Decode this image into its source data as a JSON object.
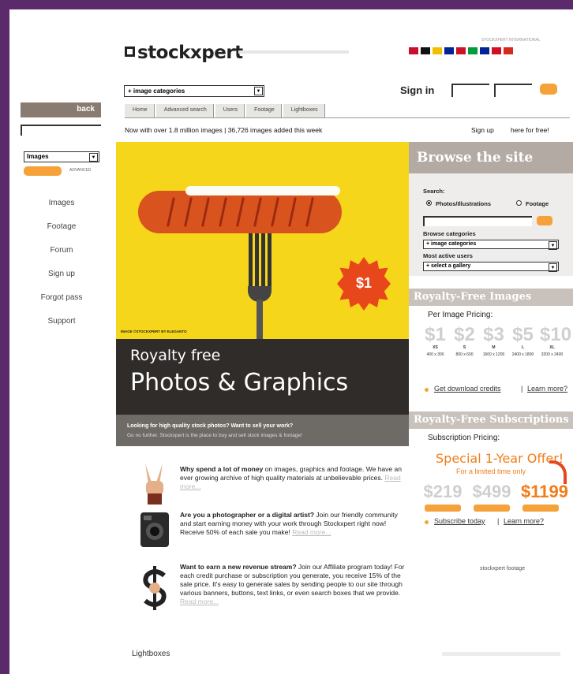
{
  "header": {
    "logo_text": "stockxpert",
    "international_label": "STOCKXPERT INTERNATIONAL",
    "flag_colors": [
      "#c8102e",
      "#111111",
      "#f1bf00",
      "#002395",
      "#ce1126",
      "#009b3a",
      "#002395",
      "#ce1126",
      "#d52b1e"
    ],
    "category_select": "+ image categories",
    "sign_in": "Sign in",
    "stats": "Now with over 1.8 million images | 36,726 images added this week",
    "sign_up": "Sign up",
    "free": "here for free!"
  },
  "tabs": [
    "Home",
    "Advanced search",
    "Users",
    "Footage",
    "Lightboxes"
  ],
  "left": {
    "back": "back",
    "select": "Images",
    "advanced": "ADVANCED",
    "nav": [
      "Images",
      "Footage",
      "Forum",
      "Sign up",
      "Forgot pass",
      "Support"
    ]
  },
  "hero": {
    "price_badge": "$1",
    "credit": "IMAGE ©STOCKXPERT BY ELEGANTO",
    "line1": "Royalty free",
    "line2": "Photos & Graphics",
    "tag1": "Looking for high quality stock photos? Want to sell your work?",
    "tag2": "Go no further. Stockxpert is the place to buy and sell stock images & footage!"
  },
  "browse": {
    "heading": "Browse the site",
    "search_label": "Search:",
    "radio_photos": "Photos/Illustrations",
    "radio_footage": "Footage",
    "browse_categories": "Browse categories",
    "categories_select": "+ image categories",
    "most_active": "Most active users",
    "gallery_select": "+ select a gallery"
  },
  "royalty": {
    "heading": "Royalty-Free Images",
    "pricing": "Per Image Pricing:",
    "prices": [
      {
        "value": "$1",
        "size": "XS",
        "dim": "400 x 300"
      },
      {
        "value": "$2",
        "size": "S",
        "dim": "800 x 600"
      },
      {
        "value": "$3",
        "size": "M",
        "dim": "1600 x 1200"
      },
      {
        "value": "$5",
        "size": "L",
        "dim": "2400 x 1800"
      },
      {
        "value": "$10",
        "size": "XL",
        "dim": "3200 x 2400"
      }
    ],
    "credits_link": "Get download credits",
    "learn_more": "Learn more?"
  },
  "subscriptions": {
    "heading": "Royalty-Free Subscriptions",
    "pricing": "Subscription Pricing:",
    "special": "Special 1-Year Offer!",
    "limited": "For a limited time only",
    "prices": [
      "$219",
      "$499",
      "$1199"
    ],
    "subscribe_link": "Subscribe today",
    "learn_more": "Learn more?",
    "footage_logo": "stockxpert footage"
  },
  "promos": [
    {
      "bold": "Why spend a lot of money",
      "text": " on images, graphics and footage. We have an ever growing archive of high quality materials at unbelievable prices.",
      "more": "Read more..."
    },
    {
      "bold": "Are you a photographer or a digital artist?",
      "text": " Join our friendly community and start earning money with your work through Stockxpert right now! Receive 50% of each sale you make!",
      "more": "Read more..."
    },
    {
      "bold": "Want to earn a new revenue stream?",
      "text": " Join our Affiliate program today! For each credit purchase or subscription you generate, you receive 15% of the sale price. It's easy to generate sales by sending people to our site through various banners, buttons, text links, or even search boxes that we provide.",
      "more": "Read more..."
    }
  ],
  "footer": {
    "lightboxes": "Lightboxes"
  }
}
